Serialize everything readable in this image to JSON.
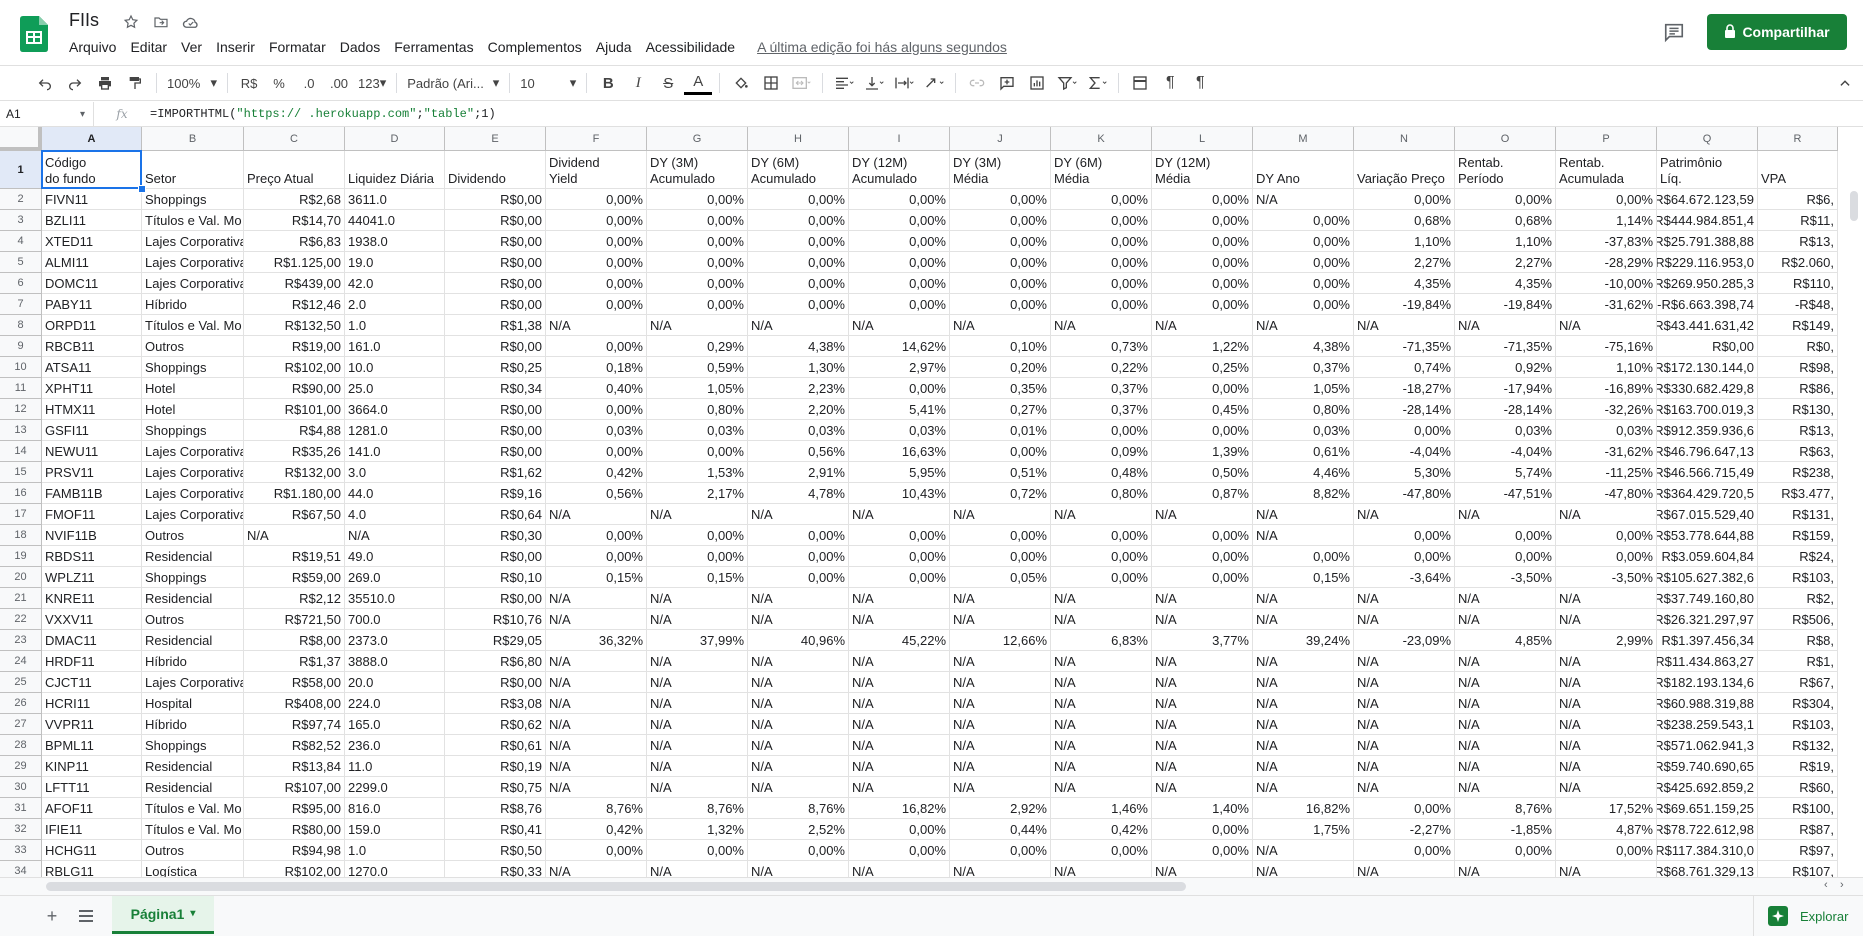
{
  "app": {
    "title": "FIIs",
    "menus": [
      "Arquivo",
      "Editar",
      "Ver",
      "Inserir",
      "Formatar",
      "Dados",
      "Ferramentas",
      "Complementos",
      "Ajuda",
      "Acessibilidade"
    ],
    "last_edit": "A última edição foi hás alguns segundos",
    "share_label": "Compartilhar",
    "brand_color": "#188038"
  },
  "toolbar": {
    "zoom": "100%",
    "currency": "R$",
    "percent": "%",
    "dec_less": ".0",
    "dec_more": ".00",
    "more_formats": "123",
    "font": "Padrão (Ari...",
    "font_size": "10",
    "bold": "B",
    "italic": "I",
    "strike": "S",
    "text_color": "A"
  },
  "formula_bar": {
    "cell_ref": "A1",
    "fx": "fx",
    "formula_prefix": "=IMPORTHTML(",
    "formula_url": "\"https://                     .herokuapp.com\"",
    "formula_sep1": ";",
    "formula_table": "\"table\"",
    "formula_rest": ";1)"
  },
  "columns": [
    "A",
    "B",
    "C",
    "D",
    "E",
    "F",
    "G",
    "H",
    "I",
    "J",
    "K",
    "L",
    "M",
    "N",
    "O",
    "P",
    "Q",
    "R"
  ],
  "header_row": [
    "Código\ndo fundo",
    "Setor",
    "Preço Atual",
    "Liquidez Diária",
    "Dividendo",
    "Dividend\nYield",
    "DY (3M)\nAcumulado",
    "DY (6M)\nAcumulado",
    "DY (12M)\nAcumulado",
    "DY (3M)\nMédia",
    "DY (6M)\nMédia",
    "DY (12M)\nMédia",
    "DY Ano",
    "Variação Preço",
    "Rentab.\nPeríodo",
    "Rentab.\nAcumulada",
    "Patrimônio\nLíq.",
    "VPA"
  ],
  "rows": [
    [
      "FIVN11",
      "Shoppings",
      "R$2,68",
      "3611.0",
      "R$0,00",
      "0,00%",
      "0,00%",
      "0,00%",
      "0,00%",
      "0,00%",
      "0,00%",
      "0,00%",
      "N/A",
      "0,00%",
      "0,00%",
      "0,00%",
      "R$64.672.123,59",
      "R$6,"
    ],
    [
      "BZLI11",
      "Títulos e Val. Mo",
      "R$14,70",
      "44041.0",
      "R$0,00",
      "0,00%",
      "0,00%",
      "0,00%",
      "0,00%",
      "0,00%",
      "0,00%",
      "0,00%",
      "0,00%",
      "0,68%",
      "0,68%",
      "1,14%",
      "R$444.984.851,4",
      "R$11,"
    ],
    [
      "XTED11",
      "Lajes Corporativa",
      "R$6,83",
      "1938.0",
      "R$0,00",
      "0,00%",
      "0,00%",
      "0,00%",
      "0,00%",
      "0,00%",
      "0,00%",
      "0,00%",
      "0,00%",
      "1,10%",
      "1,10%",
      "-37,83%",
      "R$25.791.388,88",
      "R$13,"
    ],
    [
      "ALMI11",
      "Lajes Corporativa",
      "R$1.125,00",
      "19.0",
      "R$0,00",
      "0,00%",
      "0,00%",
      "0,00%",
      "0,00%",
      "0,00%",
      "0,00%",
      "0,00%",
      "0,00%",
      "2,27%",
      "2,27%",
      "-28,29%",
      "R$229.116.953,0",
      "R$2.060,"
    ],
    [
      "DOMC11",
      "Lajes Corporativa",
      "R$439,00",
      "42.0",
      "R$0,00",
      "0,00%",
      "0,00%",
      "0,00%",
      "0,00%",
      "0,00%",
      "0,00%",
      "0,00%",
      "0,00%",
      "4,35%",
      "4,35%",
      "-10,00%",
      "R$269.950.285,3",
      "R$110,"
    ],
    [
      "PABY11",
      "Híbrido",
      "R$12,46",
      "2.0",
      "R$0,00",
      "0,00%",
      "0,00%",
      "0,00%",
      "0,00%",
      "0,00%",
      "0,00%",
      "0,00%",
      "0,00%",
      "-19,84%",
      "-19,84%",
      "-31,62%",
      "-R$6.663.398,74",
      "-R$48,"
    ],
    [
      "ORPD11",
      "Títulos e Val. Mo",
      "R$132,50",
      "1.0",
      "R$1,38",
      "N/A",
      "N/A",
      "N/A",
      "N/A",
      "N/A",
      "N/A",
      "N/A",
      "N/A",
      "N/A",
      "N/A",
      "N/A",
      "R$43.441.631,42",
      "R$149,"
    ],
    [
      "RBCB11",
      "Outros",
      "R$19,00",
      "161.0",
      "R$0,00",
      "0,00%",
      "0,29%",
      "4,38%",
      "14,62%",
      "0,10%",
      "0,73%",
      "1,22%",
      "4,38%",
      "-71,35%",
      "-71,35%",
      "-75,16%",
      "R$0,00",
      "R$0,"
    ],
    [
      "ATSA11",
      "Shoppings",
      "R$102,00",
      "10.0",
      "R$0,25",
      "0,18%",
      "0,59%",
      "1,30%",
      "2,97%",
      "0,20%",
      "0,22%",
      "0,25%",
      "0,37%",
      "0,74%",
      "0,92%",
      "1,10%",
      "R$172.130.144,0",
      "R$98,"
    ],
    [
      "XPHT11",
      "Hotel",
      "R$90,00",
      "25.0",
      "R$0,34",
      "0,40%",
      "1,05%",
      "2,23%",
      "0,00%",
      "0,35%",
      "0,37%",
      "0,00%",
      "1,05%",
      "-18,27%",
      "-17,94%",
      "-16,89%",
      "R$330.682.429,8",
      "R$86,"
    ],
    [
      "HTMX11",
      "Hotel",
      "R$101,00",
      "3664.0",
      "R$0,00",
      "0,00%",
      "0,80%",
      "2,20%",
      "5,41%",
      "0,27%",
      "0,37%",
      "0,45%",
      "0,80%",
      "-28,14%",
      "-28,14%",
      "-32,26%",
      "R$163.700.019,3",
      "R$130,"
    ],
    [
      "GSFI11",
      "Shoppings",
      "R$4,88",
      "1281.0",
      "R$0,00",
      "0,03%",
      "0,03%",
      "0,03%",
      "0,03%",
      "0,01%",
      "0,00%",
      "0,00%",
      "0,03%",
      "0,00%",
      "0,03%",
      "0,03%",
      "R$912.359.936,6",
      "R$13,"
    ],
    [
      "NEWU11",
      "Lajes Corporativa",
      "R$35,26",
      "141.0",
      "R$0,00",
      "0,00%",
      "0,00%",
      "0,56%",
      "16,63%",
      "0,00%",
      "0,09%",
      "1,39%",
      "0,61%",
      "-4,04%",
      "-4,04%",
      "-31,62%",
      "R$46.796.647,13",
      "R$63,"
    ],
    [
      "PRSV11",
      "Lajes Corporativa",
      "R$132,00",
      "3.0",
      "R$1,62",
      "0,42%",
      "1,53%",
      "2,91%",
      "5,95%",
      "0,51%",
      "0,48%",
      "0,50%",
      "4,46%",
      "5,30%",
      "5,74%",
      "-11,25%",
      "R$46.566.715,49",
      "R$238,"
    ],
    [
      "FAMB11B",
      "Lajes Corporativa",
      "R$1.180,00",
      "44.0",
      "R$9,16",
      "0,56%",
      "2,17%",
      "4,78%",
      "10,43%",
      "0,72%",
      "0,80%",
      "0,87%",
      "8,82%",
      "-47,80%",
      "-47,51%",
      "-47,80%",
      "R$364.429.720,5",
      "R$3.477,"
    ],
    [
      "FMOF11",
      "Lajes Corporativa",
      "R$67,50",
      "4.0",
      "R$0,64",
      "N/A",
      "N/A",
      "N/A",
      "N/A",
      "N/A",
      "N/A",
      "N/A",
      "N/A",
      "N/A",
      "N/A",
      "N/A",
      "R$67.015.529,40",
      "R$131,"
    ],
    [
      "NVIF11B",
      "Outros",
      "N/A",
      "N/A",
      "R$0,30",
      "0,00%",
      "0,00%",
      "0,00%",
      "0,00%",
      "0,00%",
      "0,00%",
      "0,00%",
      "N/A",
      "0,00%",
      "0,00%",
      "0,00%",
      "R$53.778.644,88",
      "R$159,"
    ],
    [
      "RBDS11",
      "Residencial",
      "R$19,51",
      "49.0",
      "R$0,00",
      "0,00%",
      "0,00%",
      "0,00%",
      "0,00%",
      "0,00%",
      "0,00%",
      "0,00%",
      "0,00%",
      "0,00%",
      "0,00%",
      "0,00%",
      "R$3.059.604,84",
      "R$24,"
    ],
    [
      "WPLZ11",
      "Shoppings",
      "R$59,00",
      "269.0",
      "R$0,10",
      "0,15%",
      "0,15%",
      "0,00%",
      "0,00%",
      "0,05%",
      "0,00%",
      "0,00%",
      "0,15%",
      "-3,64%",
      "-3,50%",
      "-3,50%",
      "R$105.627.382,6",
      "R$103,"
    ],
    [
      "KNRE11",
      "Residencial",
      "R$2,12",
      "35510.0",
      "R$0,00",
      "N/A",
      "N/A",
      "N/A",
      "N/A",
      "N/A",
      "N/A",
      "N/A",
      "N/A",
      "N/A",
      "N/A",
      "N/A",
      "R$37.749.160,80",
      "R$2,"
    ],
    [
      "VXXV11",
      "Outros",
      "R$721,50",
      "700.0",
      "R$10,76",
      "N/A",
      "N/A",
      "N/A",
      "N/A",
      "N/A",
      "N/A",
      "N/A",
      "N/A",
      "N/A",
      "N/A",
      "N/A",
      "R$26.321.297,97",
      "R$506,"
    ],
    [
      "DMAC11",
      "Residencial",
      "R$8,00",
      "2373.0",
      "R$29,05",
      "36,32%",
      "37,99%",
      "40,96%",
      "45,22%",
      "12,66%",
      "6,83%",
      "3,77%",
      "39,24%",
      "-23,09%",
      "4,85%",
      "2,99%",
      "R$1.397.456,34",
      "R$8,"
    ],
    [
      "HRDF11",
      "Híbrido",
      "R$1,37",
      "3888.0",
      "R$6,80",
      "N/A",
      "N/A",
      "N/A",
      "N/A",
      "N/A",
      "N/A",
      "N/A",
      "N/A",
      "N/A",
      "N/A",
      "N/A",
      "R$11.434.863,27",
      "R$1,"
    ],
    [
      "CJCT11",
      "Lajes Corporativa",
      "R$58,00",
      "20.0",
      "R$0,00",
      "N/A",
      "N/A",
      "N/A",
      "N/A",
      "N/A",
      "N/A",
      "N/A",
      "N/A",
      "N/A",
      "N/A",
      "N/A",
      "R$182.193.134,6",
      "R$67,"
    ],
    [
      "HCRI11",
      "Hospital",
      "R$408,00",
      "224.0",
      "R$3,08",
      "N/A",
      "N/A",
      "N/A",
      "N/A",
      "N/A",
      "N/A",
      "N/A",
      "N/A",
      "N/A",
      "N/A",
      "N/A",
      "R$60.988.319,88",
      "R$304,"
    ],
    [
      "VVPR11",
      "Híbrido",
      "R$97,74",
      "165.0",
      "R$0,62",
      "N/A",
      "N/A",
      "N/A",
      "N/A",
      "N/A",
      "N/A",
      "N/A",
      "N/A",
      "N/A",
      "N/A",
      "N/A",
      "R$238.259.543,1",
      "R$103,"
    ],
    [
      "BPML11",
      "Shoppings",
      "R$82,52",
      "236.0",
      "R$0,61",
      "N/A",
      "N/A",
      "N/A",
      "N/A",
      "N/A",
      "N/A",
      "N/A",
      "N/A",
      "N/A",
      "N/A",
      "N/A",
      "R$571.062.941,3",
      "R$132,"
    ],
    [
      "KINP11",
      "Residencial",
      "R$13,84",
      "11.0",
      "R$0,19",
      "N/A",
      "N/A",
      "N/A",
      "N/A",
      "N/A",
      "N/A",
      "N/A",
      "N/A",
      "N/A",
      "N/A",
      "N/A",
      "R$59.740.690,65",
      "R$19,"
    ],
    [
      "LFTT11",
      "Residencial",
      "R$107,00",
      "2299.0",
      "R$0,75",
      "N/A",
      "N/A",
      "N/A",
      "N/A",
      "N/A",
      "N/A",
      "N/A",
      "N/A",
      "N/A",
      "N/A",
      "N/A",
      "R$425.692.859,2",
      "R$60,"
    ],
    [
      "AFOF11",
      "Títulos e Val. Mo",
      "R$95,00",
      "816.0",
      "R$8,76",
      "8,76%",
      "8,76%",
      "8,76%",
      "16,82%",
      "2,92%",
      "1,46%",
      "1,40%",
      "16,82%",
      "0,00%",
      "8,76%",
      "17,52%",
      "R$69.651.159,25",
      "R$100,"
    ],
    [
      "IFIE11",
      "Títulos e Val. Mo",
      "R$80,00",
      "159.0",
      "R$0,41",
      "0,42%",
      "1,32%",
      "2,52%",
      "0,00%",
      "0,44%",
      "0,42%",
      "0,00%",
      "1,75%",
      "-2,27%",
      "-1,85%",
      "4,87%",
      "R$78.722.612,98",
      "R$87,"
    ],
    [
      "HCHG11",
      "Outros",
      "R$94,98",
      "1.0",
      "R$0,50",
      "0,00%",
      "0,00%",
      "0,00%",
      "0,00%",
      "0,00%",
      "0,00%",
      "0,00%",
      "N/A",
      "0,00%",
      "0,00%",
      "0,00%",
      "R$117.384.310,0",
      "R$97,"
    ],
    [
      "RBLG11",
      "Logística",
      "R$102,00",
      "1270.0",
      "R$0,33",
      "N/A",
      "N/A",
      "N/A",
      "N/A",
      "N/A",
      "N/A",
      "N/A",
      "N/A",
      "N/A",
      "N/A",
      "N/A",
      "R$68.761.329,13",
      "R$107,"
    ]
  ],
  "row_numbers": [
    "1",
    "2",
    "3",
    "4",
    "5",
    "6",
    "7",
    "8",
    "9",
    "10",
    "11",
    "12",
    "13",
    "14",
    "15",
    "16",
    "17",
    "18",
    "19",
    "20",
    "21",
    "22",
    "23",
    "24",
    "25",
    "26",
    "27",
    "28",
    "29",
    "30",
    "31",
    "32",
    "33",
    "34"
  ],
  "sheet_tab": {
    "label": "Página1"
  },
  "explore_label": "Explorar"
}
